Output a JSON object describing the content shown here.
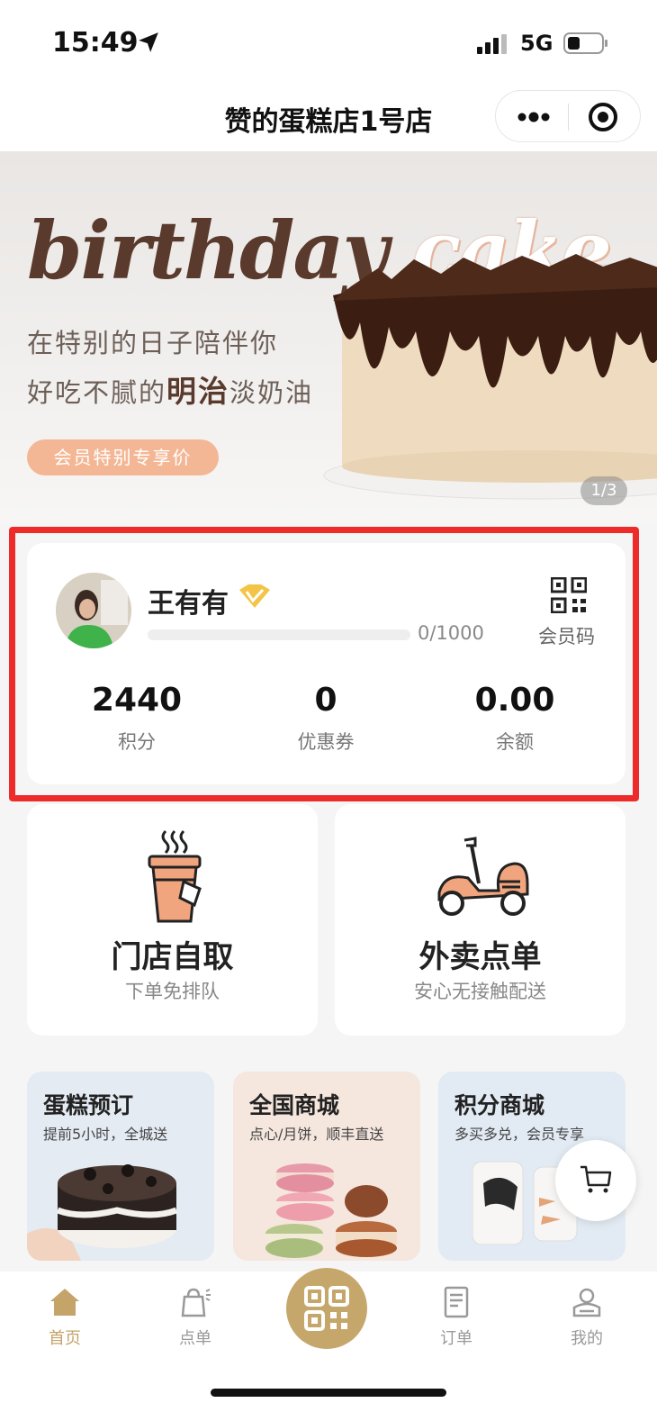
{
  "status_bar": {
    "time": "15:49",
    "network": "5G"
  },
  "nav": {
    "title": "赞的蛋糕店1号店"
  },
  "banner": {
    "script_dark": "birthday",
    "script_light": "cake",
    "line1": "在特别的日子陪伴你",
    "line2_prefix": "好吃不腻的",
    "line2_bold": "明治",
    "line2_suffix": "淡奶油",
    "pill": "会员特别专享价",
    "indicator": "1/3"
  },
  "member": {
    "name": "王有有",
    "progress_text": "0/1000",
    "progress": 0,
    "qr_label": "会员码",
    "stats": [
      {
        "value": "2440",
        "label": "积分"
      },
      {
        "value": "0",
        "label": "优惠券"
      },
      {
        "value": "0.00",
        "label": "余额"
      }
    ]
  },
  "orders": [
    {
      "title": "门店自取",
      "sub": "下单免排队",
      "icon": "coffee-cup-icon"
    },
    {
      "title": "外卖点单",
      "sub": "安心无接触配送",
      "icon": "scooter-icon"
    }
  ],
  "features": [
    {
      "title": "蛋糕预订",
      "sub": "提前5小时，全城送",
      "bg": "#e4ebf3"
    },
    {
      "title": "全国商城",
      "sub": "点心/月饼，顺丰直送",
      "bg": "#f5e6de"
    },
    {
      "title": "积分商城",
      "sub": "多买多兑，会员专享",
      "bg": "#e2eaf3"
    }
  ],
  "tabs": [
    {
      "label": "首页",
      "icon": "home-icon"
    },
    {
      "label": "点单",
      "icon": "bag-icon"
    },
    {
      "label": "订单",
      "icon": "receipt-icon"
    },
    {
      "label": "我的",
      "icon": "profile-icon"
    }
  ],
  "colors": {
    "accent": "#c6a76b",
    "highlight_frame": "#ee2b2b",
    "banner_pill": "#f4b795"
  }
}
